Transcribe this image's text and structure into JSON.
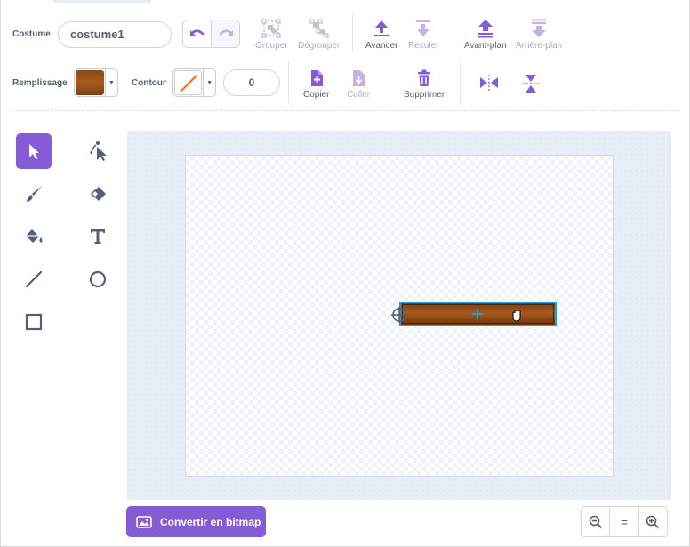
{
  "toolbar": {
    "costume_label": "Costume",
    "costume_name": "costume1",
    "group_label": "Grouper",
    "ungroup_label": "Dégrouper",
    "forward_label": "Avancer",
    "backward_label": "Reculer",
    "front_label": "Avant-plan",
    "back_label": "Arrière-plan",
    "fill_label": "Remplissage",
    "outline_label": "Contour",
    "outline_width": "0",
    "copy_label": "Copier",
    "paste_label": "Coller",
    "delete_label": "Supprimer"
  },
  "colors": {
    "accent": "#855cd6",
    "fill_color": "#a0551e",
    "outline_none_slash": "#ff6b1a",
    "selection": "#1aa0de"
  },
  "tools": [
    "select-tool",
    "reshape-tool",
    "brush-tool",
    "eraser-tool",
    "fill-tool",
    "text-tool",
    "line-tool",
    "circle-tool",
    "rectangle-tool"
  ],
  "footer": {
    "convert_label": "Convertir en bitmap",
    "zoom_reset_label": "="
  }
}
